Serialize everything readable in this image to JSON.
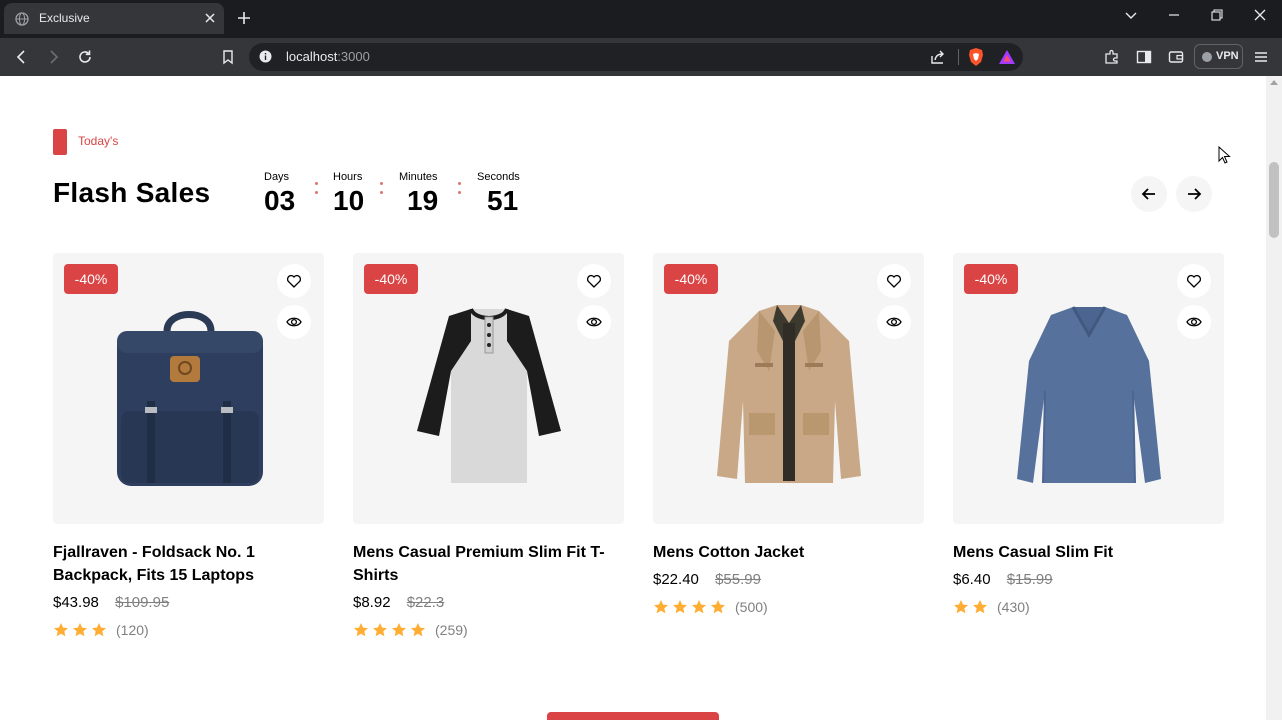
{
  "browser": {
    "tab_title": "Exclusive",
    "url_host": "localhost",
    "url_port": ":3000",
    "vpn_label": "VPN"
  },
  "section": {
    "tag": "Today's",
    "title": "Flash Sales"
  },
  "countdown": [
    {
      "label": "Days",
      "value": "03"
    },
    {
      "label": "Hours",
      "value": "10"
    },
    {
      "label": "Minutes",
      "value": "19"
    },
    {
      "label": "Seconds",
      "value": "51"
    }
  ],
  "products": [
    {
      "name": "Fjallraven - Foldsack No. 1 Backpack, Fits 15 Laptops",
      "discount": "-40%",
      "price": "$43.98",
      "old_price": "$109.95",
      "stars": 3,
      "reviews": "(120)",
      "icon": "backpack"
    },
    {
      "name": "Mens Casual Premium Slim Fit T-Shirts",
      "discount": "-40%",
      "price": "$8.92",
      "old_price": "$22.3",
      "stars": 4,
      "reviews": "(259)",
      "icon": "raglan-shirt"
    },
    {
      "name": "Mens Cotton Jacket",
      "discount": "-40%",
      "price": "$22.40",
      "old_price": "$55.99",
      "stars": 4,
      "reviews": "(500)",
      "icon": "jacket"
    },
    {
      "name": "Mens Casual Slim Fit",
      "discount": "-40%",
      "price": "$6.40",
      "old_price": "$15.99",
      "stars": 2,
      "reviews": "(430)",
      "icon": "long-sleeve-shirt"
    }
  ],
  "colors": {
    "accent": "#db4444",
    "star": "#ffad33",
    "muted": "#808080",
    "card_bg": "#f5f5f5"
  }
}
